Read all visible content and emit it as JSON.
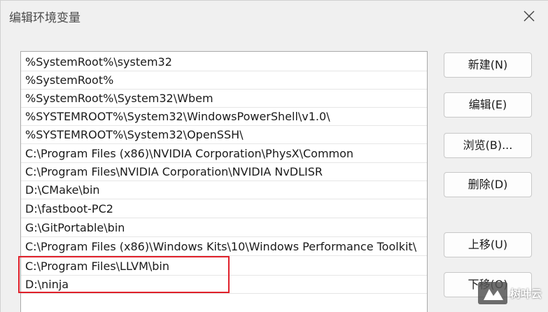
{
  "window": {
    "title": "编辑环境变量"
  },
  "path_list": {
    "items": [
      "%SystemRoot%\\system32",
      "%SystemRoot%",
      "%SystemRoot%\\System32\\Wbem",
      "%SYSTEMROOT%\\System32\\WindowsPowerShell\\v1.0\\",
      "%SYSTEMROOT%\\System32\\OpenSSH\\",
      "C:\\Program Files (x86)\\NVIDIA Corporation\\PhysX\\Common",
      "C:\\Program Files\\NVIDIA Corporation\\NVIDIA NvDLISR",
      "D:\\CMake\\bin",
      "D:\\fastboot-PC2",
      "G:\\GitPortable\\bin",
      "C:\\Program Files (x86)\\Windows Kits\\10\\Windows Performance Toolkit\\",
      "C:\\Program Files\\LLVM\\bin",
      "D:\\ninja"
    ]
  },
  "buttons": {
    "new": "新建(N)",
    "edit": "编辑(E)",
    "browse": "浏览(B)...",
    "delete": "删除(D)",
    "move_up": "上移(U)",
    "move_down": "下移(O)"
  },
  "watermark": {
    "text": "树叶云"
  },
  "colors": {
    "highlight": "#e0202a"
  }
}
